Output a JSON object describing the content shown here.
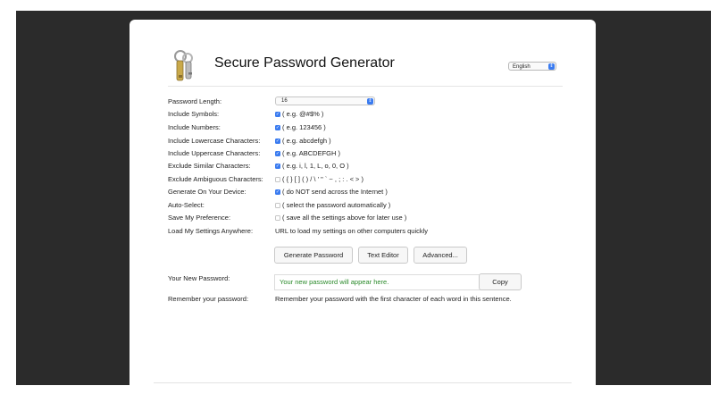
{
  "header": {
    "title": "Secure Password Generator",
    "language": "English"
  },
  "options": {
    "password_length": {
      "label": "Password Length:",
      "value": "16"
    },
    "include_symbols": {
      "label": "Include Symbols:",
      "hint": "( e.g. @#$% )",
      "checked": true
    },
    "include_numbers": {
      "label": "Include Numbers:",
      "hint": "( e.g. 123456 )",
      "checked": true
    },
    "include_lowercase": {
      "label": "Include Lowercase Characters:",
      "hint": "( e.g. abcdefgh )",
      "checked": true
    },
    "include_uppercase": {
      "label": "Include Uppercase Characters:",
      "hint": "( e.g. ABCDEFGH )",
      "checked": true
    },
    "exclude_similar": {
      "label": "Exclude Similar Characters:",
      "hint": "( e.g. i, l, 1, L, o, 0, O )",
      "checked": true
    },
    "exclude_ambiguous": {
      "label": "Exclude Ambiguous Characters:",
      "hint": "( { } [ ] ( ) / \\ ' \" ` ~ , ; : . < > )",
      "checked": false
    },
    "generate_on_device": {
      "label": "Generate On Your Device:",
      "hint": "( do NOT send across the Internet )",
      "checked": true
    },
    "auto_select": {
      "label": "Auto-Select:",
      "hint": "( select the password automatically )",
      "checked": false
    },
    "save_preference": {
      "label": "Save My Preference:",
      "hint": "( save all the settings above for later use )",
      "checked": false
    },
    "load_settings": {
      "label": "Load My Settings Anywhere:",
      "hint": "URL to load my settings on other computers quickly"
    }
  },
  "buttons": {
    "generate": "Generate Password",
    "text_editor": "Text Editor",
    "advanced": "Advanced...",
    "copy": "Copy"
  },
  "result": {
    "label": "Your New Password:",
    "placeholder": "Your new password will appear here.",
    "remember_label": "Remember your password:",
    "remember_text": "Remember your password with the first character of each word in this sentence."
  },
  "colors": {
    "checkbox_accent": "#3a7bf0",
    "password_text": "#2a8a2a",
    "backdrop": "#2b2b2b"
  }
}
